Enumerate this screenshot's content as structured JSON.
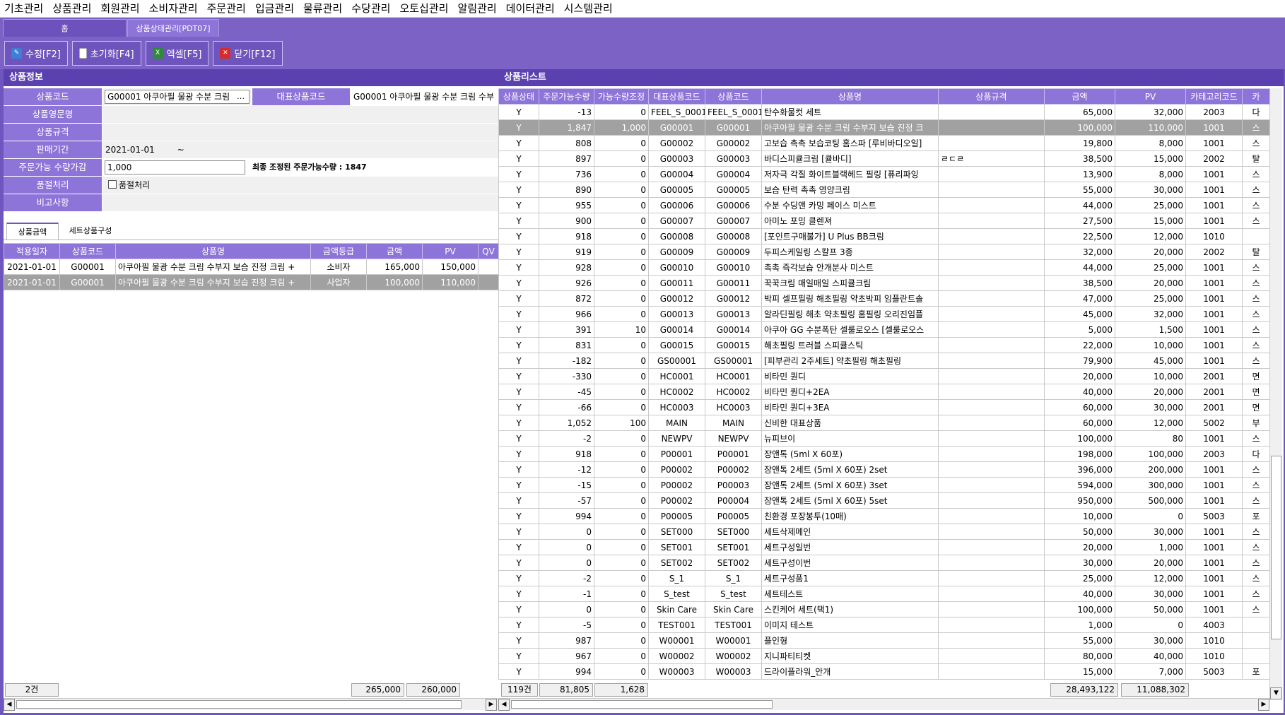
{
  "menu": [
    "기초관리",
    "상품관리",
    "회원관리",
    "소비자관리",
    "주문관리",
    "입금관리",
    "물류관리",
    "수당관리",
    "오토십관리",
    "알림관리",
    "데이터관리",
    "시스템관리"
  ],
  "tabs": {
    "home": "홈",
    "active": "상품상태관리[PDT07]"
  },
  "toolbar": {
    "edit": "수정[F2]",
    "reset": "초기화[F4]",
    "excel": "엑셀[F5]",
    "close": "닫기[F12]"
  },
  "left": {
    "title": "상품정보",
    "labels": {
      "code": "상품코드",
      "rep_code": "대표상품코드",
      "eng_name": "상품영문명",
      "spec": "상품규격",
      "sale_period": "판매기간",
      "order_adj": "주문가능 수량가감",
      "soldout": "품절처리",
      "remark": "비고사항"
    },
    "values": {
      "code": "G00001 아쿠아필 물광 수분 크림",
      "code_btn": "…",
      "rep_code": "G00001 아쿠아필 물광 수분 크림 수부",
      "sale_from": "2021-01-01",
      "sale_sep": "~",
      "order_adj": "1,000",
      "final_note": "최종 조정된 주문가능수량 : 1847",
      "soldout_chk": "품절처리"
    },
    "subtabs": [
      "상품금액",
      "세트상품구성"
    ],
    "grid_headers": [
      "적용일자",
      "상품코드",
      "상품명",
      "금액등급",
      "금액",
      "PV",
      "QV"
    ],
    "grid_rows": [
      [
        "2021-01-01",
        "G00001",
        "아쿠아필 물광 수분 크림 수부지 보습 진정 크림 +",
        "소비자",
        "165,000",
        "150,000",
        ""
      ],
      [
        "2021-01-01",
        "G00001",
        "아쿠아필 물광 수분 크림 수부지 보습 진정 크림 +",
        "사업자",
        "100,000",
        "110,000",
        ""
      ]
    ],
    "footer": {
      "count": "2건",
      "amount": "265,000",
      "pv": "260,000"
    }
  },
  "right": {
    "title": "상품리스트",
    "headers": [
      "상품상태",
      "주문가능수량",
      "가능수량조정",
      "대표상품코드",
      "상품코드",
      "상품명",
      "상품규격",
      "금액",
      "PV",
      "카테고리코드",
      "카"
    ],
    "rows": [
      [
        "Y",
        "-13",
        "0",
        "FEEL_S_0001",
        "FEEL_S_0001",
        "탄수화물컷 세트",
        "",
        "65,000",
        "32,000",
        "2003",
        "다"
      ],
      [
        "Y",
        "1,847",
        "1,000",
        "G00001",
        "G00001",
        "아쿠아필 물광 수분 크림 수부지 보습 진정 크",
        "",
        "100,000",
        "110,000",
        "1001",
        "스"
      ],
      [
        "Y",
        "808",
        "0",
        "G00002",
        "G00002",
        "고보습 촉촉 보습코팅 홈스파 [루비바디오일]",
        "",
        "19,800",
        "8,000",
        "1001",
        "스"
      ],
      [
        "Y",
        "897",
        "0",
        "G00003",
        "G00003",
        "바디스피큘크림 [큘바디]",
        "ㄹㄷㄹ",
        "38,500",
        "15,000",
        "2002",
        "탈"
      ],
      [
        "Y",
        "736",
        "0",
        "G00004",
        "G00004",
        "저자극 각질 화이트블랙헤드 필링 [퓨리파잉",
        "",
        "13,900",
        "8,000",
        "1001",
        "스"
      ],
      [
        "Y",
        "890",
        "0",
        "G00005",
        "G00005",
        "보습 탄력 촉촉 영양크림",
        "",
        "55,000",
        "30,000",
        "1001",
        "스"
      ],
      [
        "Y",
        "955",
        "0",
        "G00006",
        "G00006",
        "수분 수딩앤 카밍 페이스 미스트",
        "",
        "44,000",
        "25,000",
        "1001",
        "스"
      ],
      [
        "Y",
        "900",
        "0",
        "G00007",
        "G00007",
        "아미노 포밍 클렌져",
        "",
        "27,500",
        "15,000",
        "1001",
        "스"
      ],
      [
        "Y",
        "918",
        "0",
        "G00008",
        "G00008",
        "[포인트구매불가] U Plus BB크림",
        "",
        "22,500",
        "12,000",
        "1010",
        ""
      ],
      [
        "Y",
        "919",
        "0",
        "G00009",
        "G00009",
        "두피스케일링 스칼프 3종",
        "",
        "32,000",
        "20,000",
        "2002",
        "탈"
      ],
      [
        "Y",
        "928",
        "0",
        "G00010",
        "G00010",
        "촉촉 즉각보습 안개분사 미스트",
        "",
        "44,000",
        "25,000",
        "1001",
        "스"
      ],
      [
        "Y",
        "926",
        "0",
        "G00011",
        "G00011",
        "꾹꾹크림 매일매일 스피큘크림",
        "",
        "38,500",
        "20,000",
        "1001",
        "스"
      ],
      [
        "Y",
        "872",
        "0",
        "G00012",
        "G00012",
        "박피 셀프필링 해초필링 약초박피 임플란트솔",
        "",
        "47,000",
        "25,000",
        "1001",
        "스"
      ],
      [
        "Y",
        "966",
        "0",
        "G00013",
        "G00013",
        "알라딘필링 해초 약초필링 홈필링 오리진임플",
        "",
        "45,000",
        "32,000",
        "1001",
        "스"
      ],
      [
        "Y",
        "391",
        "10",
        "G00014",
        "G00014",
        "아쿠아 GG 수분폭탄 셀룰로오스 [셀룰로오스",
        "",
        "5,000",
        "1,500",
        "1001",
        "스"
      ],
      [
        "Y",
        "831",
        "0",
        "G00015",
        "G00015",
        "해초필링 트러블 스피큘스틱",
        "",
        "22,000",
        "10,000",
        "1001",
        "스"
      ],
      [
        "Y",
        "-182",
        "0",
        "GS00001",
        "GS00001",
        "[피부관리 2주세트] 약초필링 해초필링",
        "",
        "79,900",
        "45,000",
        "1001",
        "스"
      ],
      [
        "Y",
        "-330",
        "0",
        "HC0001",
        "HC0001",
        "비타민 퀀디",
        "",
        "20,000",
        "10,000",
        "2001",
        "면"
      ],
      [
        "Y",
        "-45",
        "0",
        "HC0002",
        "HC0002",
        "비타민 퀀디+2EA",
        "",
        "40,000",
        "20,000",
        "2001",
        "면"
      ],
      [
        "Y",
        "-66",
        "0",
        "HC0003",
        "HC0003",
        "비타민 퀀디+3EA",
        "",
        "60,000",
        "30,000",
        "2001",
        "면"
      ],
      [
        "Y",
        "1,052",
        "100",
        "MAIN",
        "MAIN",
        "신비한 대표상품",
        "",
        "60,000",
        "12,000",
        "5002",
        "부"
      ],
      [
        "Y",
        "-2",
        "0",
        "NEWPV",
        "NEWPV",
        "뉴피브이",
        "",
        "100,000",
        "80",
        "1001",
        "스"
      ],
      [
        "Y",
        "918",
        "0",
        "P00001",
        "P00001",
        "장앤톡 (5ml X 60포)",
        "",
        "198,000",
        "100,000",
        "2003",
        "다"
      ],
      [
        "Y",
        "-12",
        "0",
        "P00002",
        "P00002",
        "장앤톡 2세트 (5ml X 60포) 2set",
        "",
        "396,000",
        "200,000",
        "1001",
        "스"
      ],
      [
        "Y",
        "-15",
        "0",
        "P00002",
        "P00003",
        "장앤톡 2세트 (5ml X 60포) 3set",
        "",
        "594,000",
        "300,000",
        "1001",
        "스"
      ],
      [
        "Y",
        "-57",
        "0",
        "P00002",
        "P00004",
        "장앤톡 2세트 (5ml X 60포) 5set",
        "",
        "950,000",
        "500,000",
        "1001",
        "스"
      ],
      [
        "Y",
        "994",
        "0",
        "P00005",
        "P00005",
        "친환경 포장봉투(10매)",
        "",
        "10,000",
        "0",
        "5003",
        "포"
      ],
      [
        "Y",
        "0",
        "0",
        "SET000",
        "SET000",
        "세트삭제메인",
        "",
        "50,000",
        "30,000",
        "1001",
        "스"
      ],
      [
        "Y",
        "0",
        "0",
        "SET001",
        "SET001",
        "세트구성일번",
        "",
        "20,000",
        "1,000",
        "1001",
        "스"
      ],
      [
        "Y",
        "0",
        "0",
        "SET002",
        "SET002",
        "세트구성이번",
        "",
        "30,000",
        "20,000",
        "1001",
        "스"
      ],
      [
        "Y",
        "-2",
        "0",
        "S_1",
        "S_1",
        "세트구성품1",
        "",
        "25,000",
        "12,000",
        "1001",
        "스"
      ],
      [
        "Y",
        "-1",
        "0",
        "S_test",
        "S_test",
        "세트테스트",
        "",
        "40,000",
        "30,000",
        "1001",
        "스"
      ],
      [
        "Y",
        "0",
        "0",
        "Skin Care",
        "Skin Care",
        "스킨케어 세트(택1)",
        "",
        "100,000",
        "50,000",
        "1001",
        "스"
      ],
      [
        "Y",
        "-5",
        "0",
        "TEST001",
        "TEST001",
        "이미지 테스트",
        "",
        "1,000",
        "0",
        "4003",
        ""
      ],
      [
        "Y",
        "987",
        "0",
        "W00001",
        "W00001",
        "플인형",
        "",
        "55,000",
        "30,000",
        "1010",
        ""
      ],
      [
        "Y",
        "967",
        "0",
        "W00002",
        "W00002",
        "지니파티티켓",
        "",
        "80,000",
        "40,000",
        "1010",
        ""
      ],
      [
        "Y",
        "994",
        "0",
        "W00003",
        "W00003",
        "드라이플라워_안개",
        "",
        "15,000",
        "7,000",
        "5003",
        "포"
      ]
    ],
    "footer": {
      "count": "119건",
      "order_qty": "81,805",
      "adj": "1,628",
      "amount": "28,493,122",
      "pv": "11,088,302"
    }
  }
}
